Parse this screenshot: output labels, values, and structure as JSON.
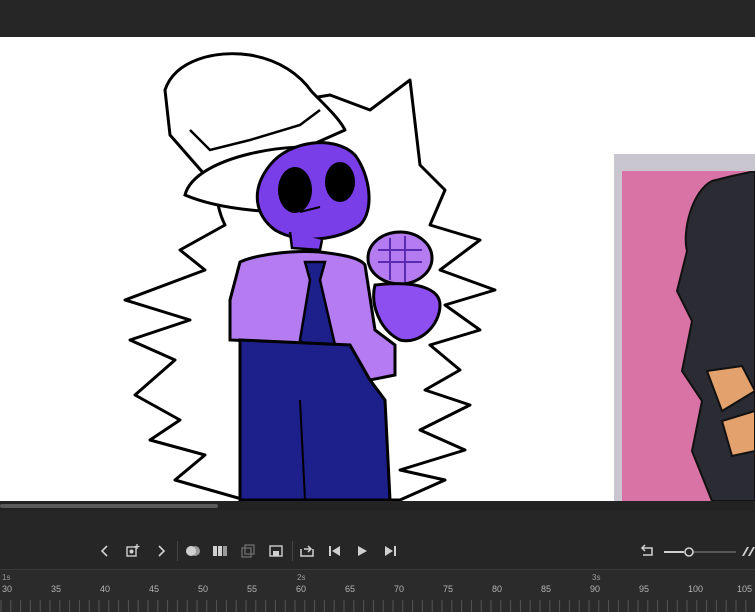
{
  "timeline": {
    "seconds": [
      "1s",
      "2s",
      "3s"
    ],
    "frames": [
      "30",
      "35",
      "40",
      "45",
      "50",
      "55",
      "60",
      "65",
      "70",
      "75",
      "80",
      "85",
      "90",
      "95",
      "100",
      "105"
    ]
  },
  "icons": {
    "prev_keyframe": "chevron-left-icon",
    "insert_keyframe": "keyframe-add-icon",
    "next_keyframe": "chevron-right-icon",
    "onion_skin": "onion-skin-icon",
    "edit_multiple_frames": "multiple-frames-icon",
    "loop": "loop-icon",
    "go_first": "step-back-icon",
    "play": "play-icon",
    "go_last": "step-forward-icon",
    "undo": "undo-icon",
    "zoom_slider": "zoom-slider-icon",
    "fit": "fit-icon"
  },
  "colors": {
    "panel_bg": "#262626",
    "stage_bg": "#ffffff",
    "character_skin": "#7a3ee8",
    "shirt": "#b47cf0",
    "pants": "#1d1f8a",
    "reference_pink": "#d973a6"
  }
}
